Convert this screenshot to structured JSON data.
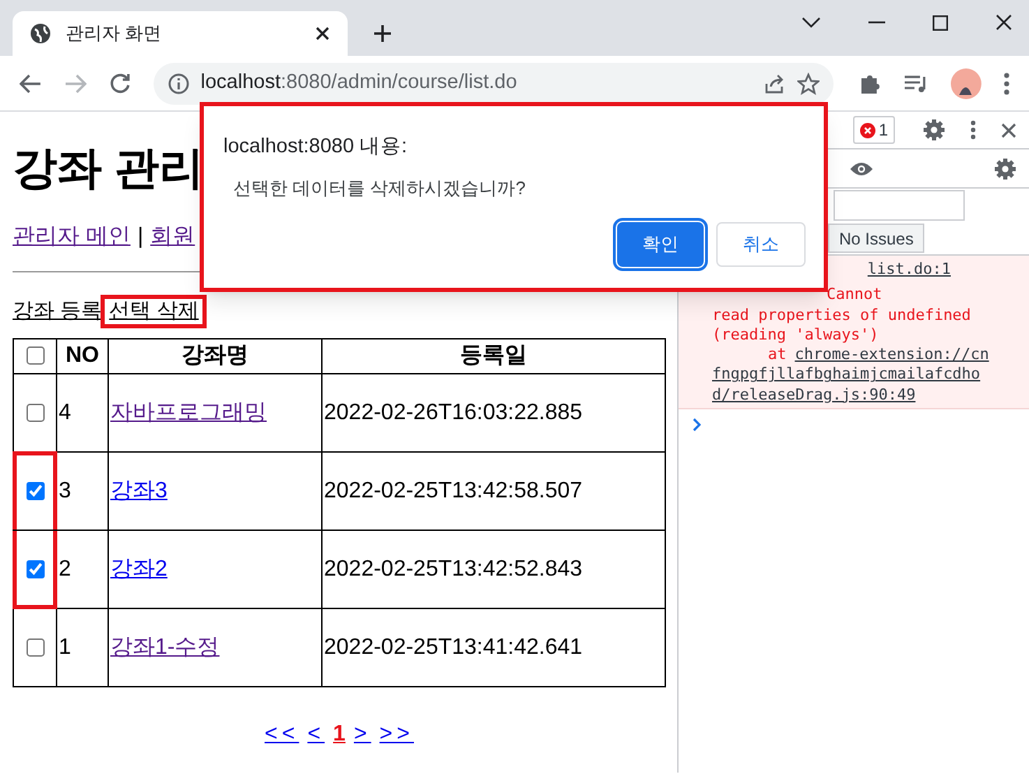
{
  "browser": {
    "tab_title": "관리자 화면",
    "url_host": "localhost",
    "url_rest": ":8080/admin/course/list.do"
  },
  "page": {
    "heading": "강좌 관리",
    "nav": [
      {
        "label": "관리자 메인",
        "visited": true
      },
      {
        "label": "회원",
        "visited": true
      }
    ],
    "nav_separator": "|",
    "actions": [
      {
        "label": "강좌 등록",
        "highlighted": false
      },
      {
        "label": "선택 삭제",
        "highlighted": true
      }
    ],
    "table": {
      "columns": [
        "NO",
        "강좌명",
        "등록일"
      ],
      "header_checked": false,
      "rows": [
        {
          "checked": false,
          "highlighted": false,
          "no": "4",
          "name": "자바프로그래밍",
          "visited": true,
          "date": "2022-02-26T16:03:22.885"
        },
        {
          "checked": true,
          "highlighted": true,
          "no": "3",
          "name": "강좌3",
          "visited": false,
          "date": "2022-02-25T13:42:58.507"
        },
        {
          "checked": true,
          "highlighted": true,
          "no": "2",
          "name": "강좌2",
          "visited": false,
          "date": "2022-02-25T13:42:52.843"
        },
        {
          "checked": false,
          "highlighted": false,
          "no": "1",
          "name": "강좌1-수정",
          "visited": true,
          "date": "2022-02-25T13:41:42.641"
        }
      ]
    },
    "pagination": [
      {
        "label": "<<",
        "selected": false
      },
      {
        "label": "<",
        "selected": false
      },
      {
        "label": "1",
        "selected": true
      },
      {
        "label": ">",
        "selected": false
      },
      {
        "label": ">>",
        "selected": false
      }
    ]
  },
  "devtools": {
    "error_count": "1",
    "issues_button": "No Issues",
    "console_message": {
      "source": "list.do:1",
      "lines": [
        "Cannot",
        "read properties of undefined",
        "(reading 'always')"
      ],
      "at": "at",
      "link": "chrome-extension://cnfngpgfjllafbghaimjcmailafcdhod/releaseDrag.js:90:49"
    }
  },
  "dialog": {
    "title": "localhost:8080 내용:",
    "message": "선택한 데이터를 삭제하시겠습니까?",
    "ok": "확인",
    "cancel": "취소",
    "highlighted": true
  }
}
